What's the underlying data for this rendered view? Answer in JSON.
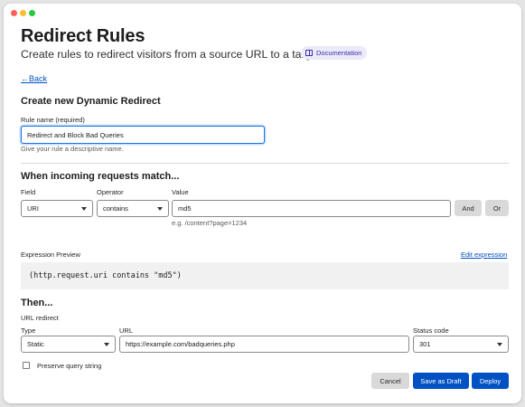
{
  "header": {
    "title": "Redirect Rules",
    "subtitle": "Create rules to redirect visitors from a source URL to a target URL.",
    "doc_badge": "Documentation"
  },
  "nav": {
    "back_label": "Back"
  },
  "create": {
    "title": "Create new Dynamic Redirect",
    "rule_name_label": "Rule name (required)",
    "rule_name_value": "Redirect and Block Bad Queries",
    "rule_name_help": "Give your rule a descriptive name."
  },
  "match": {
    "title": "When incoming requests match...",
    "field_label": "Field",
    "field_value": "URI",
    "operator_label": "Operator",
    "operator_value": "contains",
    "value_label": "Value",
    "value_value": "md5",
    "value_help": "e.g. /content?page=1234",
    "and_label": "And",
    "or_label": "Or"
  },
  "expression": {
    "label": "Expression Preview",
    "edit_label": "Edit expression",
    "code": "(http.request.uri contains \"md5\")"
  },
  "then": {
    "title": "Then...",
    "action_label": "URL redirect",
    "type_label": "Type",
    "type_value": "Static",
    "url_label": "URL",
    "url_value": "https://example.com/badqueries.php",
    "status_label": "Status code",
    "status_value": "301",
    "preserve_label": "Preserve query string",
    "preserve_checked": false
  },
  "actions": {
    "cancel": "Cancel",
    "save_draft": "Save as Draft",
    "deploy": "Deploy"
  },
  "colors": {
    "accent": "#0051c3",
    "badge_bg": "#eceaf9",
    "focus": "#1a73e8"
  }
}
